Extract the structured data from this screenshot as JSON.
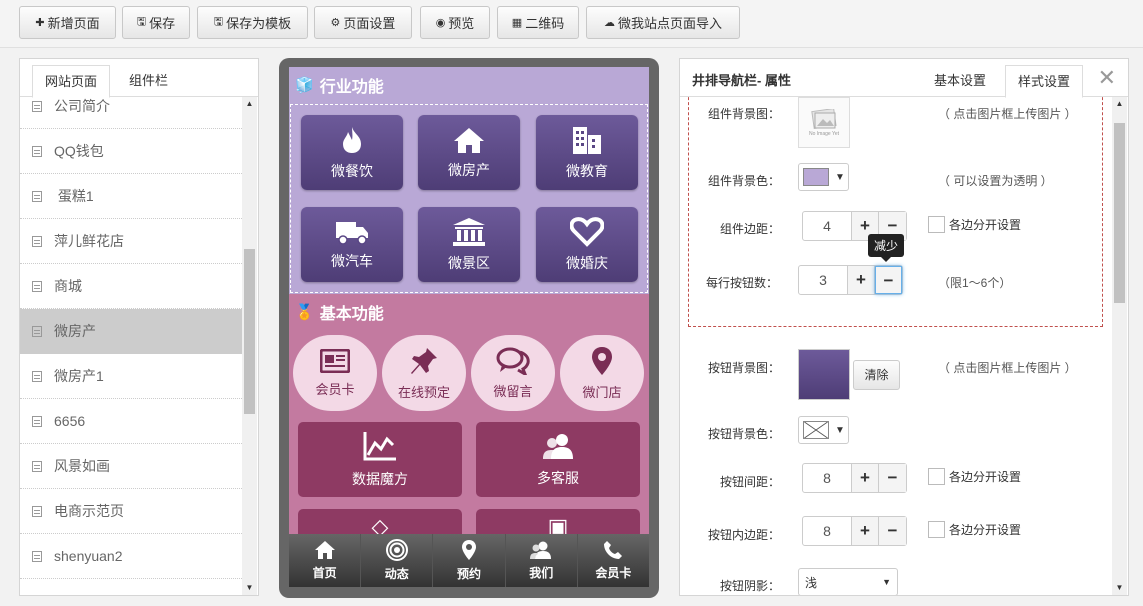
{
  "toolbar": {
    "add_page": "新增页面",
    "save": "保存",
    "save_template": "保存为模板",
    "page_settings": "页面设置",
    "preview": "预览",
    "qrcode": "二维码",
    "import": "微我站点页面导入"
  },
  "left_panel": {
    "tab_pages": "网站页面",
    "tab_widgets": "组件栏",
    "pages": [
      {
        "label": "公司简介"
      },
      {
        "label": "QQ钱包"
      },
      {
        "label": " 蛋糕1"
      },
      {
        "label": "萍儿鲜花店"
      },
      {
        "label": "商城"
      },
      {
        "label": "微房产"
      },
      {
        "label": "微房产1"
      },
      {
        "label": "6656"
      },
      {
        "label": "风景如画"
      },
      {
        "label": "电商示范页"
      },
      {
        "label": "shenyuan2"
      }
    ],
    "selected_index": 5
  },
  "phone": {
    "section1_title": "行业功能",
    "section1_buttons": [
      {
        "label": "微餐饮",
        "icon": "fire-icon"
      },
      {
        "label": "微房产",
        "icon": "home-icon"
      },
      {
        "label": "微教育",
        "icon": "building-icon"
      },
      {
        "label": "微汽车",
        "icon": "truck-icon"
      },
      {
        "label": "微景区",
        "icon": "bank-icon"
      },
      {
        "label": "微婚庆",
        "icon": "heart-icon"
      }
    ],
    "section2_title": "基本功能",
    "section2_circles": [
      {
        "label": "会员卡",
        "icon": "newspaper-icon"
      },
      {
        "label": "在线预定",
        "icon": "pushpin-icon"
      },
      {
        "label": "微留言",
        "icon": "chat-icon"
      },
      {
        "label": "微门店",
        "icon": "map-marker-icon"
      }
    ],
    "section2_squares": [
      {
        "label": "数据魔方",
        "icon": "chart-icon"
      },
      {
        "label": "多客服",
        "icon": "users-icon"
      }
    ],
    "bottom_nav": [
      {
        "label": "首页",
        "icon": "home-icon"
      },
      {
        "label": "动态",
        "icon": "broadcast-icon"
      },
      {
        "label": "预约",
        "icon": "map-marker-icon"
      },
      {
        "label": "我们",
        "icon": "users-icon"
      },
      {
        "label": "会员卡",
        "icon": "phone-icon"
      }
    ],
    "colors": {
      "section1_bg": "#b9a8d6",
      "section2_bg": "#c37aa0",
      "button_purple": "#4e3d76"
    }
  },
  "right_panel": {
    "title": "井排导航栏- 属性",
    "tab_basic": "基本设置",
    "tab_style": "样式设置",
    "widget_bg_image_label": "组件背景图：",
    "no_image_text": "No Image Yet",
    "widget_bg_image_hint": "（ 点击图片框上传图片 ）",
    "widget_bg_color_label": "组件背景色：",
    "widget_bg_color_hint": "（ 可以设置为透明 ）",
    "widget_bg_color": "#b9a8d6",
    "widget_margin_label": "组件边距：",
    "widget_margin_value": "4",
    "separate_sides": "各边分开设置",
    "per_row_label": "每行按钮数：",
    "per_row_value": "3",
    "per_row_hint": "（限1～6个）",
    "tooltip_decrease": "减少",
    "btn_bg_image_label": "按钮背景图：",
    "btn_bg_image_hint": "（ 点击图片框上传图片 ）",
    "clear": "清除",
    "btn_bg_color_label": "按钮背景色：",
    "btn_spacing_label": "按钮间距：",
    "btn_spacing_value": "8",
    "btn_padding_label": "按钮内边距：",
    "btn_padding_value": "8",
    "btn_shadow_label": "按钮阴影：",
    "btn_shadow_value": "浅",
    "plus": "+",
    "minus": "−"
  }
}
